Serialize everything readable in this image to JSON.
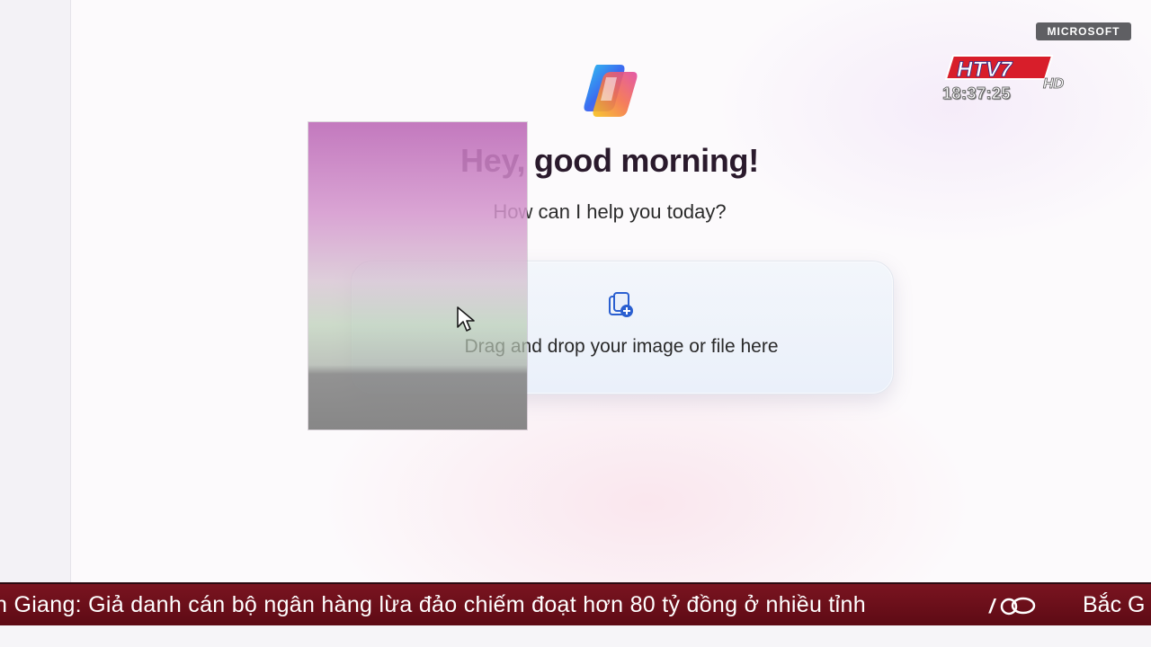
{
  "overlay": {
    "badge": "MICROSOFT",
    "channel_logo": "HTV7",
    "channel_logo_suffix": "HD",
    "clock": "18:37:25"
  },
  "copilot": {
    "logo_icon": "copilot-logo-icon",
    "greeting": "Hey, good morning!",
    "subtitle": "How can I help you today?",
    "drop_zone": {
      "icon": "file-add-icon",
      "label": "Drag and drop your image or file here"
    }
  },
  "ticker": {
    "text": "n Giang: Giả danh cán bộ ngân hàng lừa đảo chiếm đoạt hơn 80 tỷ đồng ở nhiều tỉnh",
    "separator_icon": "channel-mark-icon",
    "next_text": "Bắc G"
  },
  "colors": {
    "ticker_bg": "#6a0f1a",
    "badge_bg": "#5f5f63",
    "drop_zone_bg": "#eef2f9"
  }
}
